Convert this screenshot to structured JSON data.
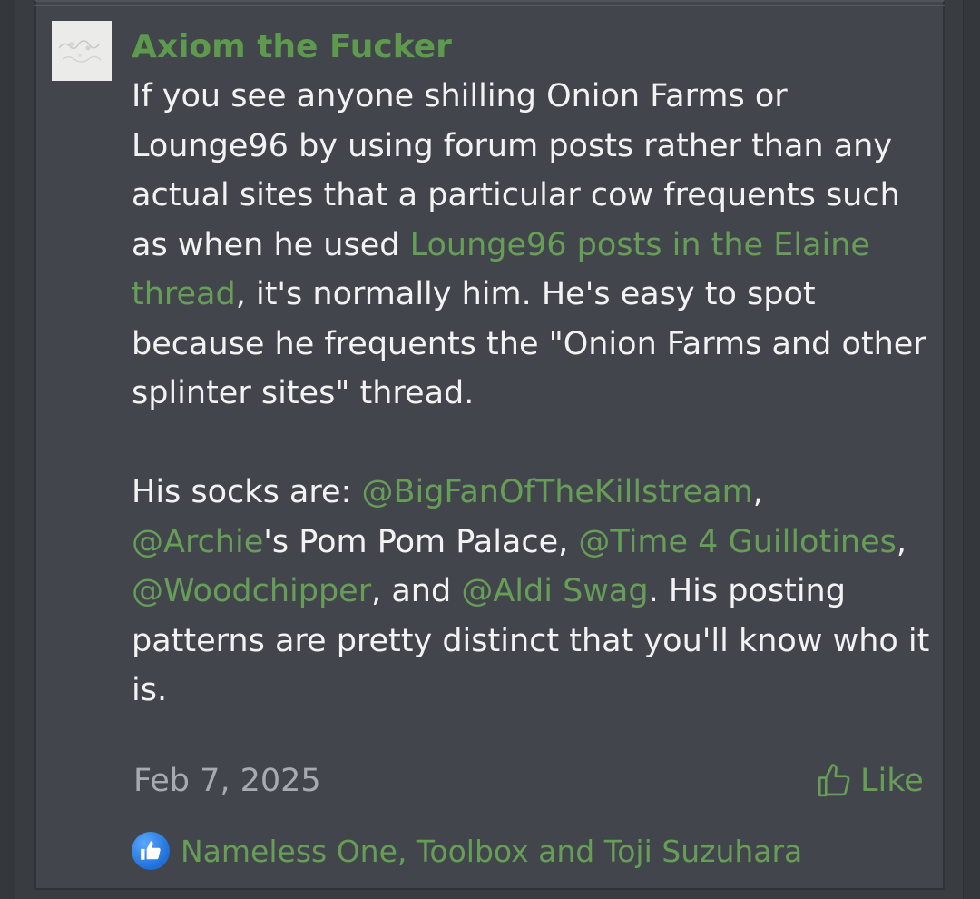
{
  "post": {
    "author": "Axiom the Fucker",
    "paragraph1": {
      "t1": "If you see anyone shilling Onion Farms or Lounge96 by using forum posts rather than any actual sites that a particular cow frequents such as when he used ",
      "link": "Lounge96 posts in the Elaine thread",
      "t2": ", it's normally him. He's easy to spot because he frequents the \"Onion Farms and other splinter sites\" thread."
    },
    "paragraph2": {
      "t1": "His socks are: ",
      "m1": "@BigFanOfTheKillstream",
      "t2": ", ",
      "m2": "@Archie",
      "t3": "'s Pom Pom Palace, ",
      "m3": "@Time 4 Guillotines",
      "t4": ", ",
      "m4": "@Woodchipper",
      "t5": ", and ",
      "m5": "@Aldi Swag",
      "t6": ". His posting patterns are pretty distinct that you'll know who it is."
    },
    "date": "Feb 7, 2025",
    "like_label": "Like",
    "reactions": "Nameless One, Toolbox and Toji Suzuhara"
  },
  "icons": {
    "like": "thumbs-up-outline-icon",
    "reaction": "like-reaction-icon"
  },
  "colors": {
    "accent": "#679e57",
    "author": "#5e9a4e",
    "text": "#f2f2f2",
    "muted": "#a7abaf",
    "card_bg": "#42464c"
  }
}
